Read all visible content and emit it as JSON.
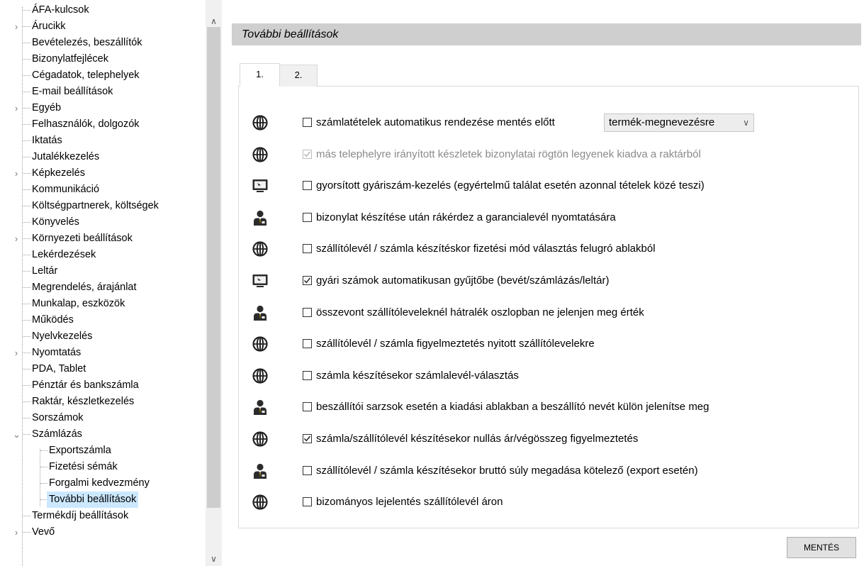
{
  "tree": {
    "items": [
      {
        "label": "ÁFA-kulcsok"
      },
      {
        "label": "Árucikk"
      },
      {
        "label": "Bevételezés, beszállítók"
      },
      {
        "label": "Bizonylatfejlécek"
      },
      {
        "label": "Cégadatok, telephelyek"
      },
      {
        "label": "E-mail beállítások"
      },
      {
        "label": "Egyéb"
      },
      {
        "label": "Felhasználók, dolgozók"
      },
      {
        "label": "Iktatás"
      },
      {
        "label": "Jutalékkezelés"
      },
      {
        "label": "Képkezelés"
      },
      {
        "label": "Kommunikáció"
      },
      {
        "label": "Költségpartnerek, költségek"
      },
      {
        "label": "Könyvelés"
      },
      {
        "label": "Környezeti beállítások"
      },
      {
        "label": "Lekérdezések"
      },
      {
        "label": "Leltár"
      },
      {
        "label": "Megrendelés, árajánlat"
      },
      {
        "label": "Munkalap, eszközök"
      },
      {
        "label": "Működés"
      },
      {
        "label": "Nyelvkezelés"
      },
      {
        "label": "Nyomtatás"
      },
      {
        "label": "PDA, Tablet"
      },
      {
        "label": "Pénztár és bankszámla"
      },
      {
        "label": "Raktár, készletkezelés"
      },
      {
        "label": "Sorszámok"
      },
      {
        "label": "Számlázás"
      },
      {
        "label": "Exportszámla"
      },
      {
        "label": "Fizetési sémák"
      },
      {
        "label": "Forgalmi kedvezmény"
      },
      {
        "label": "További beállítások"
      },
      {
        "label": "Termékdíj beállítások"
      },
      {
        "label": "Vevő"
      }
    ]
  },
  "header": {
    "title": "További beállítások"
  },
  "tabs": [
    {
      "label": "1.",
      "active": true
    },
    {
      "label": "2.",
      "active": false
    }
  ],
  "select": {
    "value": "termék-megnevezésre"
  },
  "options": [
    {
      "icon": "globe-icon",
      "checked": false,
      "disabled": false,
      "label": "számlatételek automatikus rendezése mentés előtt"
    },
    {
      "icon": "globe-icon",
      "checked": true,
      "disabled": true,
      "label": "más telephelyre irányított készletek bizonylatai rögtön legyenek kiadva a raktárból"
    },
    {
      "icon": "monitor-icon",
      "checked": false,
      "disabled": false,
      "label": "gyorsított gyáriszám-kezelés (egyértelmű találat esetén azonnal tételek közé teszi)"
    },
    {
      "icon": "user-icon",
      "checked": false,
      "disabled": false,
      "label": "bizonylat készítése után rákérdez a garancialevél nyomtatására"
    },
    {
      "icon": "globe-icon",
      "checked": false,
      "disabled": false,
      "label": "szállítólevél / számla készítéskor fizetési mód választás felugró ablakból"
    },
    {
      "icon": "monitor-icon",
      "checked": true,
      "disabled": false,
      "label": "gyári számok automatikusan gyűjtőbe (bevét/számlázás/leltár)"
    },
    {
      "icon": "user-icon",
      "checked": false,
      "disabled": false,
      "label": "összevont szállítóleveleknél hátralék oszlopban ne jelenjen meg érték"
    },
    {
      "icon": "globe-icon",
      "checked": false,
      "disabled": false,
      "label": "szállítólevél / számla figyelmeztetés nyitott szállítólevelekre"
    },
    {
      "icon": "globe-icon",
      "checked": false,
      "disabled": false,
      "label": "számla készítésekor számlalevél-választás"
    },
    {
      "icon": "user-icon",
      "checked": false,
      "disabled": false,
      "label": "beszállítói sarzsok esetén a kiadási ablakban a beszállító nevét külön jelenítse meg"
    },
    {
      "icon": "globe-icon",
      "checked": true,
      "disabled": false,
      "label": "számla/szállítólevél készítésekor nullás ár/végösszeg figyelmeztetés"
    },
    {
      "icon": "user-icon",
      "checked": false,
      "disabled": false,
      "label": "szállítólevél / számla készítésekor bruttó súly megadása kötelező (export esetén)"
    },
    {
      "icon": "globe-icon",
      "checked": false,
      "disabled": false,
      "label": "bizományos lejelentés szállítólevél áron"
    }
  ],
  "buttons": {
    "save": "MENTÉS"
  }
}
